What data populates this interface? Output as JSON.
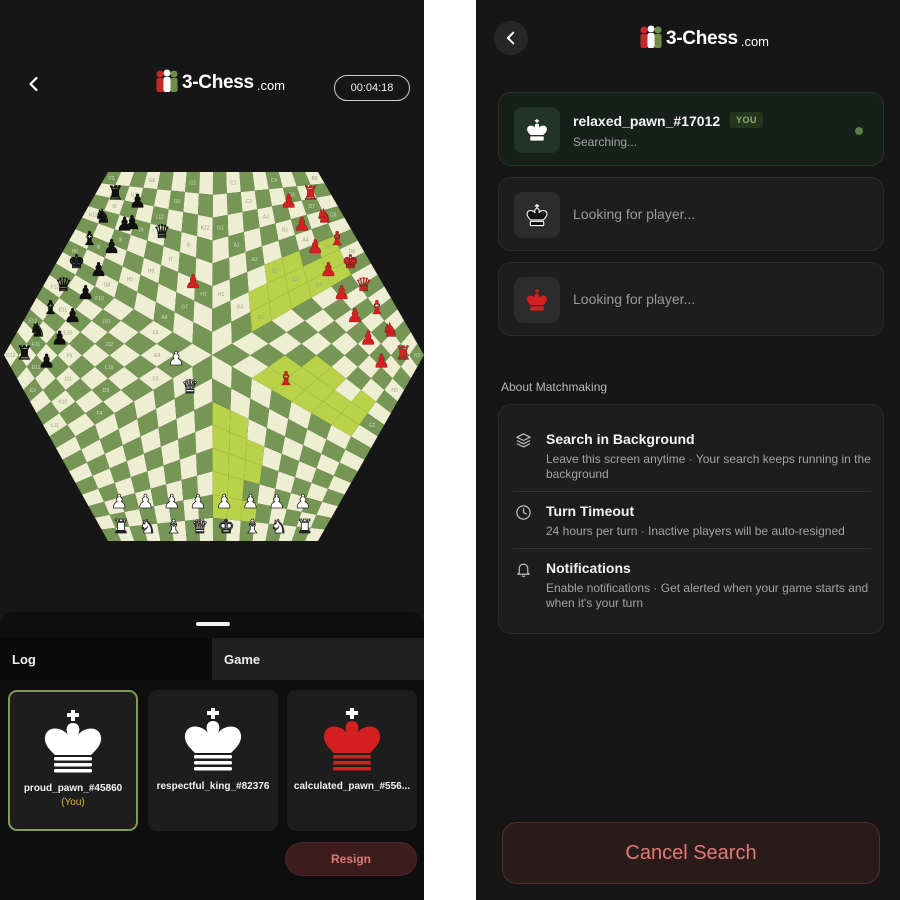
{
  "brand": {
    "logo_main": "3-Chess",
    "logo_domain": ".com"
  },
  "game": {
    "timer": "00:04:18",
    "tabs": {
      "log": "Log",
      "game": "Game"
    },
    "players": [
      {
        "name": "proud_pawn_#45860",
        "tag": "(You)",
        "piece": "white-king"
      },
      {
        "name": "respectful_king_#82376",
        "tag": "",
        "piece": "white-king"
      },
      {
        "name": "calculated_pawn_#556...",
        "tag": "",
        "piece": "red-king"
      }
    ],
    "resign_label": "Resign"
  },
  "matchmaking": {
    "slots": [
      {
        "name": "relaxed_pawn_#17012",
        "badge": "YOU",
        "status": "Searching..."
      },
      {
        "waiting": "Looking for player..."
      },
      {
        "waiting": "Looking for player..."
      }
    ],
    "about_title": "About Matchmaking",
    "info": [
      {
        "icon": "layers-icon",
        "title": "Search in Background",
        "desc": "Leave this screen anytime · Your search keeps running in the background"
      },
      {
        "icon": "clock-icon",
        "title": "Turn Timeout",
        "desc": "24 hours per turn · Inactive players will be auto-resigned"
      },
      {
        "icon": "bell-icon",
        "title": "Notifications",
        "desc": "Enable notifications · Get alerted when your game starts and when it's your turn"
      }
    ],
    "cancel_label": "Cancel Search"
  },
  "colors": {
    "light_square": "#eeeed2",
    "dark_square": "#769656",
    "highlight": "#b9d24a",
    "red_piece": "#d42020",
    "accent_green": "#7d9b5a",
    "cancel_text": "#e07b71"
  },
  "board": {
    "square_labels": [
      "D12",
      "E12",
      "F12",
      "F11",
      "E11",
      "D11",
      "E10",
      "F10",
      "E9",
      "F9",
      "J10",
      "J11",
      "J12",
      "K10",
      "L10",
      "L9",
      "L11",
      "D9",
      "E4",
      "F4",
      "E3",
      "F3",
      "E8",
      "I12",
      "I11",
      "I10",
      "I9",
      "L12",
      "K12",
      "K11",
      "J9",
      "I5",
      "I6",
      "I7",
      "I8",
      "H8",
      "H7",
      "H6",
      "H5",
      "G7",
      "G8",
      "A8",
      "B8",
      "C8",
      "D8",
      "D7",
      "D6",
      "D5",
      "A4",
      "B4",
      "C4",
      "B3",
      "C3",
      "A3",
      "B2",
      "C2",
      "A2",
      "B1",
      "C1",
      "A1",
      "G3",
      "G1",
      "H1",
      "H2",
      "H3",
      "E2"
    ],
    "pieces": {
      "white_side": [
        "rook",
        "knight",
        "bishop",
        "queen",
        "king",
        "bishop",
        "knight",
        "rook"
      ],
      "black_side": [
        "rook",
        "knight",
        "bishop",
        "king",
        "queen",
        "bishop",
        "knight",
        "rook"
      ],
      "red_side": [
        "rook",
        "knight",
        "bishop",
        "king",
        "queen",
        "bishop",
        "knight",
        "rook"
      ]
    }
  }
}
